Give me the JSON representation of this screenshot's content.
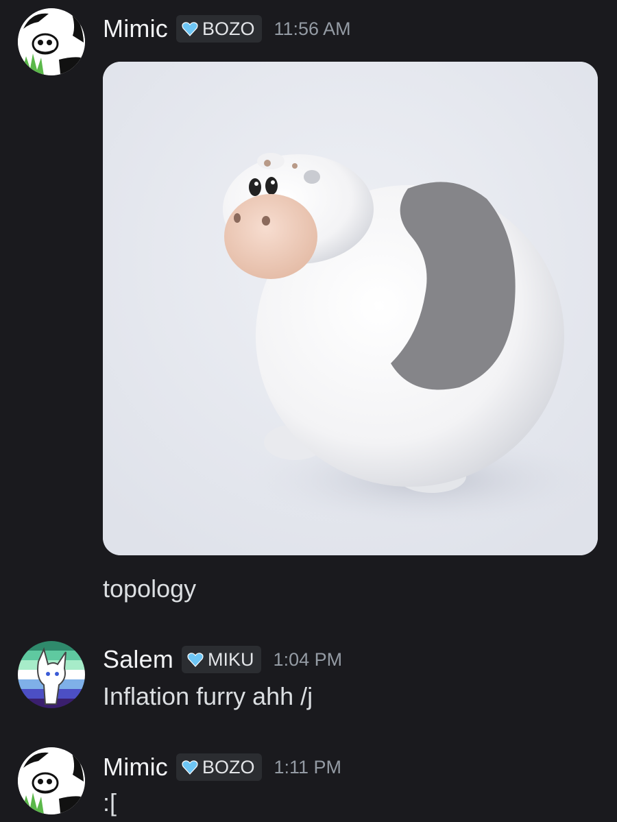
{
  "messages": [
    {
      "username": "Mimic",
      "tag": "BOZO",
      "timestamp": "11:56 AM",
      "text": "topology"
    },
    {
      "username": "Salem",
      "tag": "MIKU",
      "timestamp": "1:04 PM",
      "text": "Inflation furry ahh /j"
    },
    {
      "username": "Mimic",
      "tag": "BOZO",
      "timestamp": "1:11 PM",
      "text": ":["
    }
  ],
  "colors": {
    "background": "#1a1a1e",
    "username": "#f2f3f5",
    "tag_bg": "#2b2d31",
    "timestamp": "#949ba4",
    "heart": "#6ec6f5"
  },
  "icons": {
    "tag_icon": "blue-heart-icon"
  }
}
